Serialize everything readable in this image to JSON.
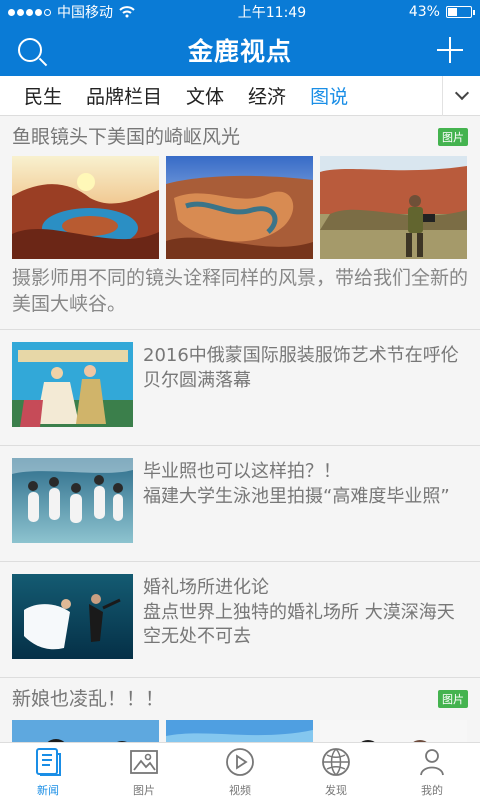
{
  "status_bar": {
    "carrier": "中国移动",
    "time": "上午11:49",
    "battery_text": "43%",
    "battery_level": 0.43
  },
  "header": {
    "title": "金鹿视点",
    "bg_color": "#0a7bd6"
  },
  "tabs": [
    {
      "label": "民生"
    },
    {
      "label": "品牌栏目"
    },
    {
      "label": "文体"
    },
    {
      "label": "经济"
    },
    {
      "label": "图说",
      "active": true
    }
  ],
  "feed": {
    "gallery1": {
      "title": "鱼眼镜头下美国的崎岖风光",
      "badge": "图片",
      "desc": "摄影师用不同的镜头诠释同样的风景，带给我们全新的美国大峡谷。"
    },
    "item2": {
      "title": "2016中俄蒙国际服装服饰艺术节在呼伦贝尔圆满落幕"
    },
    "item3": {
      "title": "毕业照也可以这样拍？！",
      "subtitle": "福建大学生泳池里拍摄“高难度毕业照”"
    },
    "item4": {
      "title": "婚礼场所进化论",
      "subtitle": "盘点世界上独特的婚礼场所 大漠深海天空无处不可去"
    },
    "gallery2": {
      "title": "新娘也凌乱！！！",
      "badge": "图片"
    }
  },
  "bottom_nav": [
    {
      "label": "新闻",
      "icon": "news-icon",
      "active": true
    },
    {
      "label": "图片",
      "icon": "image-icon"
    },
    {
      "label": "视频",
      "icon": "video-icon"
    },
    {
      "label": "发现",
      "icon": "globe-icon"
    },
    {
      "label": "我的",
      "icon": "user-icon"
    }
  ],
  "colors": {
    "accent": "#1a8ee6",
    "badge": "#44b34f",
    "text_muted": "#777777"
  }
}
